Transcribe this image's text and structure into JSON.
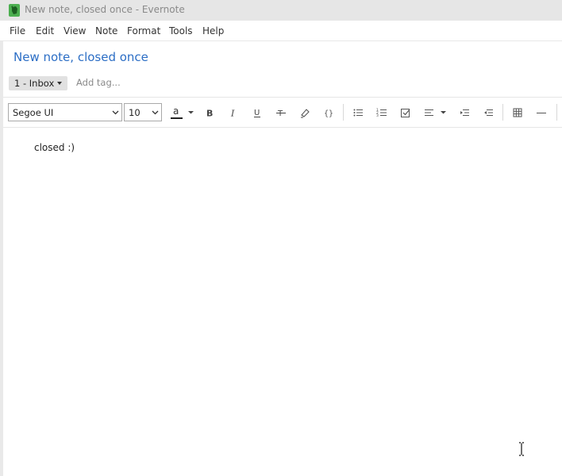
{
  "window": {
    "title": "New note, closed once - Evernote"
  },
  "menu": {
    "items": [
      "File",
      "Edit",
      "View",
      "Note",
      "Format",
      "Tools",
      "Help"
    ]
  },
  "note": {
    "title": "New note, closed once",
    "notebook": "1 - Inbox",
    "add_tag_placeholder": "Add tag...",
    "body": "closed :)"
  },
  "toolbar": {
    "font_family": "Segoe UI",
    "font_size": "10"
  },
  "colors": {
    "title_blue": "#2c6ec5",
    "evernote_green": "#4caf50"
  }
}
